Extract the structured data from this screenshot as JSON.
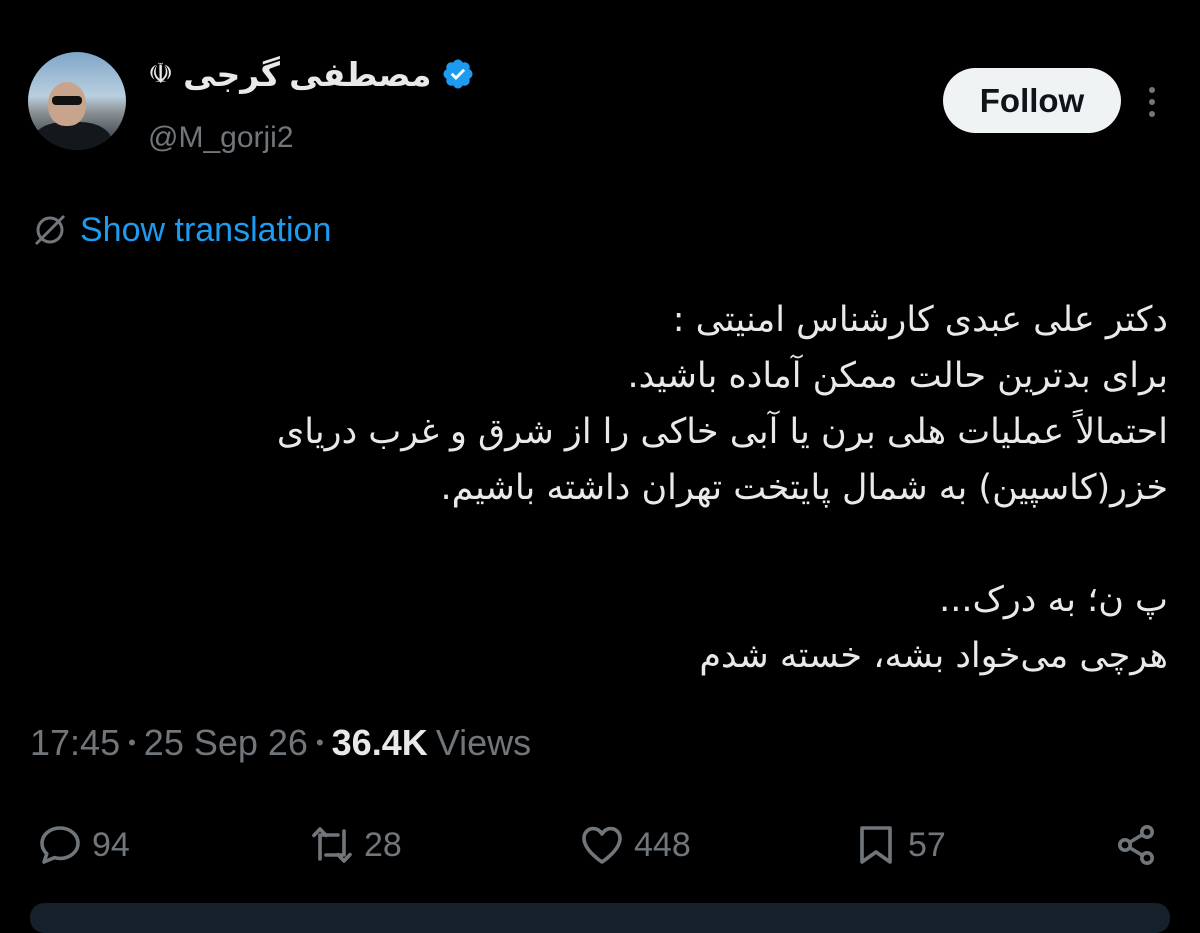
{
  "user": {
    "display_name": "مصطفی گرجی",
    "emblem": "☫",
    "handle": "@M_gorji2"
  },
  "follow_label": "Follow",
  "translation_label": "Show translation",
  "tweet": {
    "lines": [
      "دکتر علی عبدی کارشناس امنیتی :",
      "برای بدترین حالت ممکن آماده باشید.",
      "احتمالاً عملیات هلی برن یا آبی خاکی را از شرق و غرب دریای",
      "خزر(کاسپین) به شمال پایتخت تهران داشته باشیم.",
      "",
      "پ ن؛ به درک...",
      "هرچی می‌خواد بشه، خسته شدم"
    ]
  },
  "meta": {
    "time": "17:45",
    "separator": "•",
    "date": "25 Sep 26",
    "views_count": "36.4K",
    "views_label": "Views"
  },
  "actions": {
    "replies": "94",
    "reposts": "28",
    "likes": "448",
    "bookmarks": "57"
  },
  "colors": {
    "background": "#000000",
    "text": "#e7e9ea",
    "muted": "#71767b",
    "link": "#1d9bf0",
    "verified": "#1d9bf0"
  }
}
